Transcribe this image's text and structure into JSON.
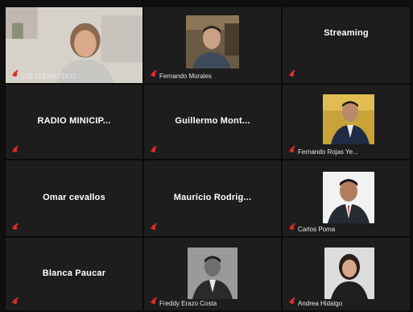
{
  "participants": [
    {
      "id": "p1",
      "label": "LUZ ELENA COLO...",
      "display_name": "",
      "has_video": true
    },
    {
      "id": "p2",
      "label": "Fernando Morales",
      "display_name": "",
      "has_video": true
    },
    {
      "id": "p3",
      "label": "",
      "display_name": "Streaming",
      "has_video": false
    },
    {
      "id": "p4",
      "label": "",
      "display_name": "RADIO MINICIP...",
      "has_video": false
    },
    {
      "id": "p5",
      "label": "",
      "display_name": "Guillermo  Mont...",
      "has_video": false
    },
    {
      "id": "p6",
      "label": "Fernando Rojas Ye...",
      "display_name": "",
      "has_video": true
    },
    {
      "id": "p7",
      "label": "",
      "display_name": "Omar cevallos",
      "has_video": false
    },
    {
      "id": "p8",
      "label": "",
      "display_name": "Mauricio  Rodrig...",
      "has_video": false
    },
    {
      "id": "p9",
      "label": "Carlos Poma",
      "display_name": "",
      "has_video": true
    },
    {
      "id": "p10",
      "label": "",
      "display_name": "Blanca Paucar",
      "has_video": false
    },
    {
      "id": "p11",
      "label": "Freddy Erazo Costa",
      "display_name": "",
      "has_video": true
    },
    {
      "id": "p12",
      "label": "Andrea Hidalgo",
      "display_name": "",
      "has_video": true
    }
  ],
  "colors": {
    "tile_bg": "#1d1d1d",
    "muted_mic": "#e02a2a"
  },
  "icons": {
    "muted": "mic-muted-icon"
  }
}
